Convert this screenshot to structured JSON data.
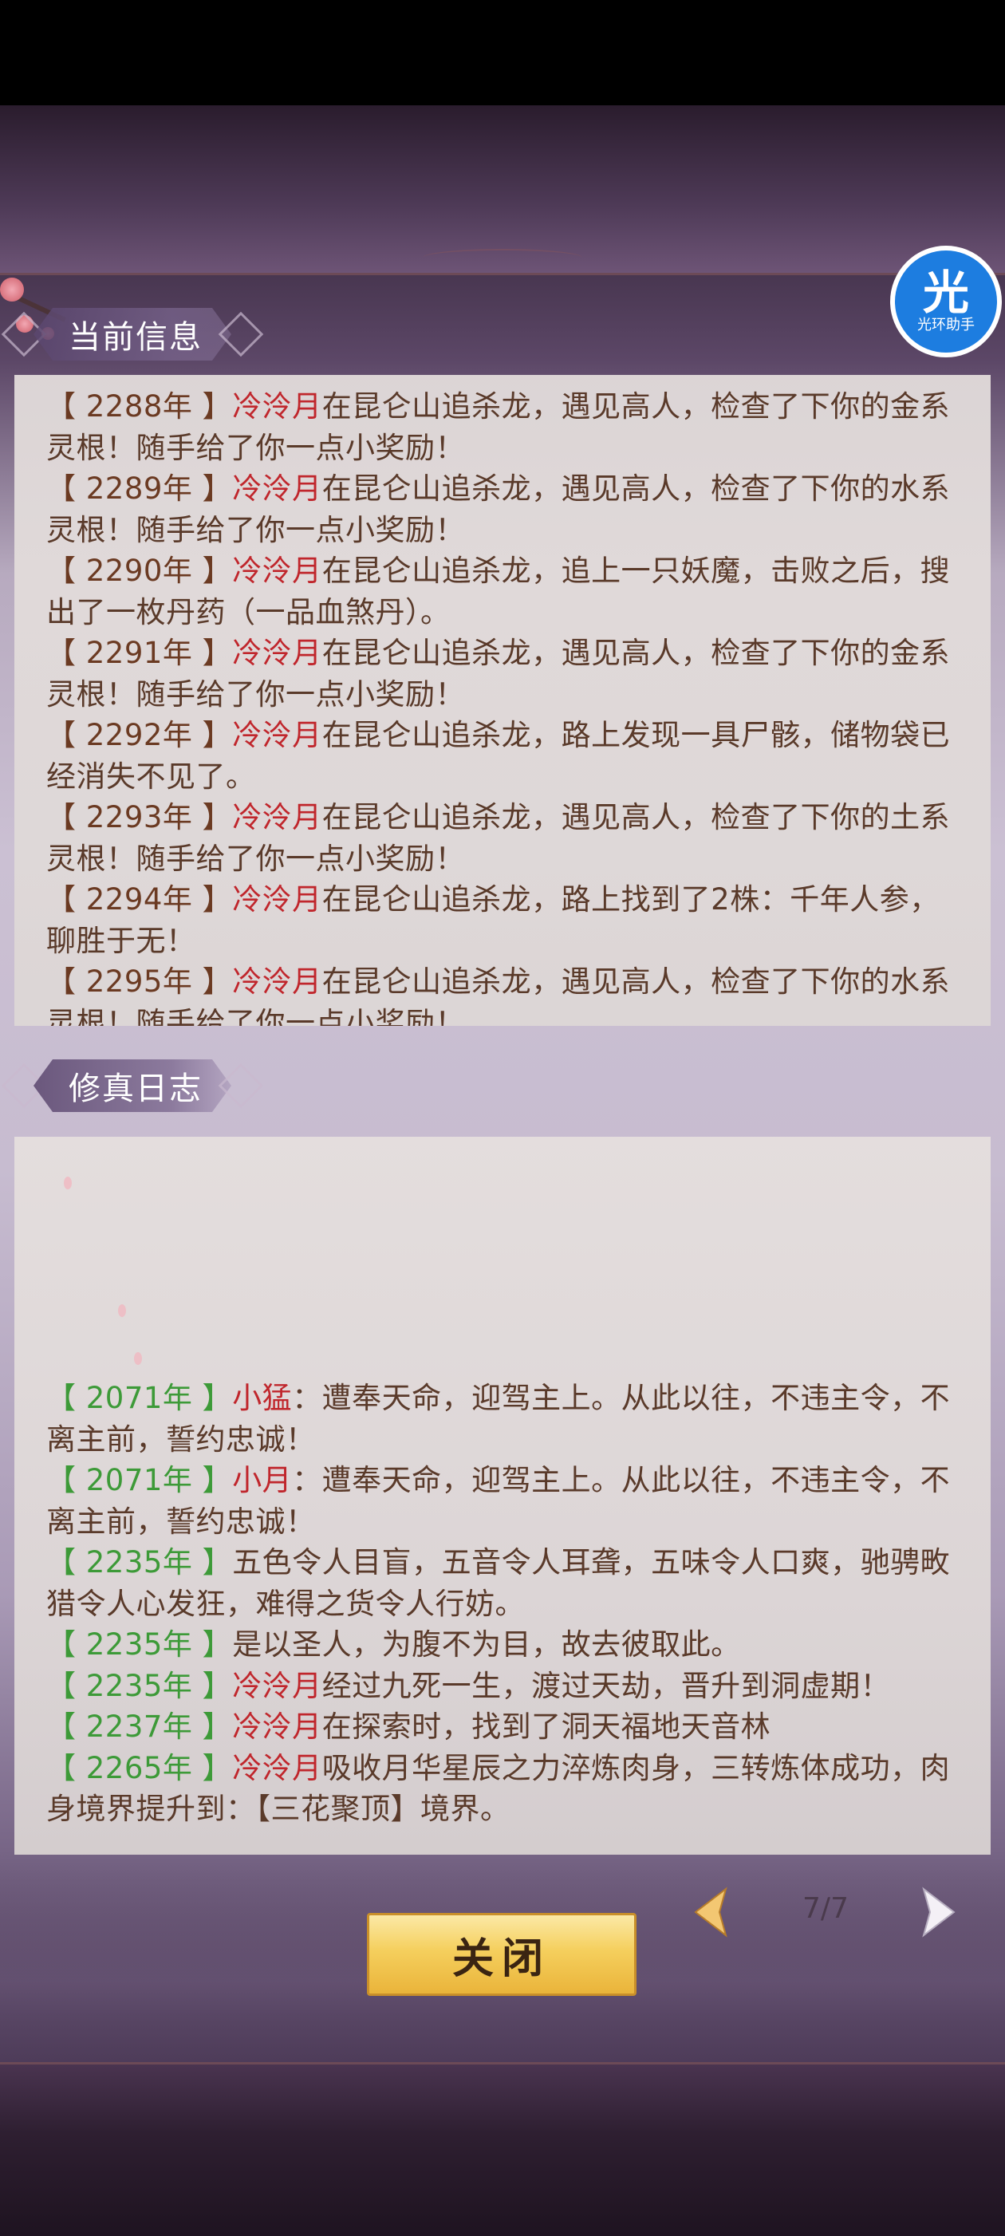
{
  "current_info": {
    "title": "当前信息",
    "entries": [
      {
        "year": "【 2288年 】",
        "name": "冷泠月",
        "text": "在昆仑山追杀龙，遇见高人，检查了下你的金系灵根！随手给了你一点小奖励！"
      },
      {
        "year": "【 2289年 】",
        "name": "冷泠月",
        "text": "在昆仑山追杀龙，遇见高人，检查了下你的水系灵根！随手给了你一点小奖励！"
      },
      {
        "year": "【 2290年 】",
        "name": "冷泠月",
        "text": "在昆仑山追杀龙，追上一只妖魔，击败之后，搜出了一枚丹药（一品血煞丹）。"
      },
      {
        "year": "【 2291年 】",
        "name": "冷泠月",
        "text": "在昆仑山追杀龙，遇见高人，检查了下你的金系灵根！随手给了你一点小奖励！"
      },
      {
        "year": "【 2292年 】",
        "name": "冷泠月",
        "text": "在昆仑山追杀龙，路上发现一具尸骸，储物袋已经消失不见了。"
      },
      {
        "year": "【 2293年 】",
        "name": "冷泠月",
        "text": "在昆仑山追杀龙，遇见高人，检查了下你的土系灵根！随手给了你一点小奖励！"
      },
      {
        "year": "【 2294年 】",
        "name": "冷泠月",
        "text": "在昆仑山追杀龙，路上找到了2株：千年人参，聊胜于无！"
      },
      {
        "year": "【 2295年 】",
        "name": "冷泠月",
        "text": "在昆仑山追杀龙，遇见高人，检查了下你的水系灵根！随手给了你一点小奖励！"
      }
    ]
  },
  "cultivation_log": {
    "title": "修真日志",
    "entries": [
      {
        "year": "【 2071年 】",
        "name": "小猛",
        "text": "：遭奉天命，迎驾主上。从此以往，不违主令，不离主前，誓约忠诚！"
      },
      {
        "year": "【 2071年 】",
        "name": "小月",
        "text": "：遭奉天命，迎驾主上。从此以往，不违主令，不离主前，誓约忠诚！"
      },
      {
        "year": "【 2235年 】",
        "name": "",
        "text": "五色令人目盲，五音令人耳聋，五味令人口爽，驰骋畋猎令人心发狂，难得之货令人行妨。"
      },
      {
        "year": "【 2235年 】",
        "name": "",
        "text": "是以圣人，为腹不为目，故去彼取此。"
      },
      {
        "year": "【 2235年 】",
        "name": "冷泠月",
        "text": "经过九死一生，渡过天劫，晋升到洞虚期！"
      },
      {
        "year": "【 2237年 】",
        "name": "冷泠月",
        "text": "在探索时，找到了洞天福地天音林"
      },
      {
        "year": "【 2265年 】",
        "name": "冷泠月",
        "text": "吸收月华星辰之力淬炼肉身，三转炼体成功，肉身境界提升到：【三花聚顶】境界。"
      }
    ]
  },
  "controls": {
    "close_label": "关闭",
    "page_indicator": "7/7"
  },
  "badge": {
    "big": "光",
    "small": "光环助手"
  },
  "colors": {
    "year_current": "#6b3a22",
    "year_log": "#3d9a38",
    "name_highlight": "#c0262c",
    "body_text": "#5a3a2a",
    "button_gold": "#f5cf5d"
  }
}
